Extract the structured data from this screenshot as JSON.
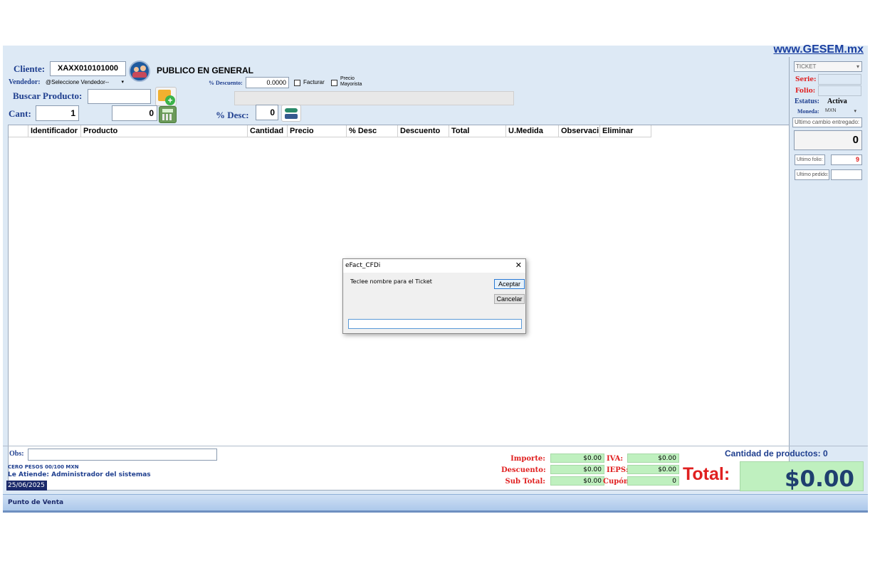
{
  "site_link": "www.GESEM.mx",
  "client": {
    "label": "Cliente:",
    "rfc": "XAXX010101000",
    "name": "PUBLICO EN GENERAL"
  },
  "vendor": {
    "label": "Vendedor:",
    "selected": "@Seleccione Vendedor--"
  },
  "discount_header": {
    "label": "% Descuento:",
    "value": "0.0000"
  },
  "facturar": {
    "label": "Facturar"
  },
  "precio_mayorista": {
    "line1": "Precio",
    "line2": "Mayorista"
  },
  "search": {
    "label": "Buscar Producto:",
    "value": ""
  },
  "qty": {
    "label": "Cant:",
    "value": "1",
    "second_value": "0"
  },
  "desc": {
    "label": "% Desc:",
    "value": "0"
  },
  "table": {
    "columns": [
      "Identificador",
      "Producto",
      "Cantidad",
      "Precio",
      "% Desc",
      "Descuento",
      "Total",
      "U.Medida",
      "Observaci",
      "Eliminar"
    ]
  },
  "right_panel": {
    "doc_type": "TICKET",
    "serie_label": "Serie:",
    "serie_value": "",
    "folio_label": "Folio:",
    "folio_value": "",
    "estatus_label": "Estatus:",
    "estatus_value": "Activa",
    "moneda_label": "Moneda:",
    "moneda_value": "MXN",
    "cambio_placeholder": "Ultimo cambio entregado:",
    "cambio_value": "0",
    "ultimo_folio_label": "Ultimo folio:",
    "ultimo_folio_value": "9",
    "ultimo_pedido_label": "Ultimo pedido:",
    "ultimo_pedido_value": ""
  },
  "dialog": {
    "title": "eFact_CFDi",
    "close": "✕",
    "prompt": "Teclee nombre para el Ticket",
    "accept": "Aceptar",
    "cancel": "Cancelar",
    "input_value": ""
  },
  "footer": {
    "obs_label": "Obs:",
    "obs_value": "",
    "amount_words": "CERO PESOS  00/100 MXN",
    "attendant": "Le Atiende: Administrador del sistemas",
    "date": "25/06/2025",
    "importe_label": "Importe:",
    "importe_value": "$0.00",
    "descuento_label": "Descuento:",
    "descuento_value": "$0.00",
    "subtotal_label": "Sub Total:",
    "subtotal_value": "$0.00",
    "iva_label": "IVA:",
    "iva_value": "$0.00",
    "ieps_label": "IEPS:",
    "ieps_value": "$0.00",
    "cupon_label": "Cupón:",
    "cupon_value": "0",
    "total_label": "Total:",
    "total_value": "$0.00",
    "product_count": "Cantidad de productos: 0"
  },
  "bottom_bar": {
    "title": "Punto de Venta"
  },
  "colors": {
    "accent_blue": "#1f3f8f",
    "total_red": "#e02020",
    "total_bg": "#bff0bf",
    "link": "#1a3fa0"
  }
}
